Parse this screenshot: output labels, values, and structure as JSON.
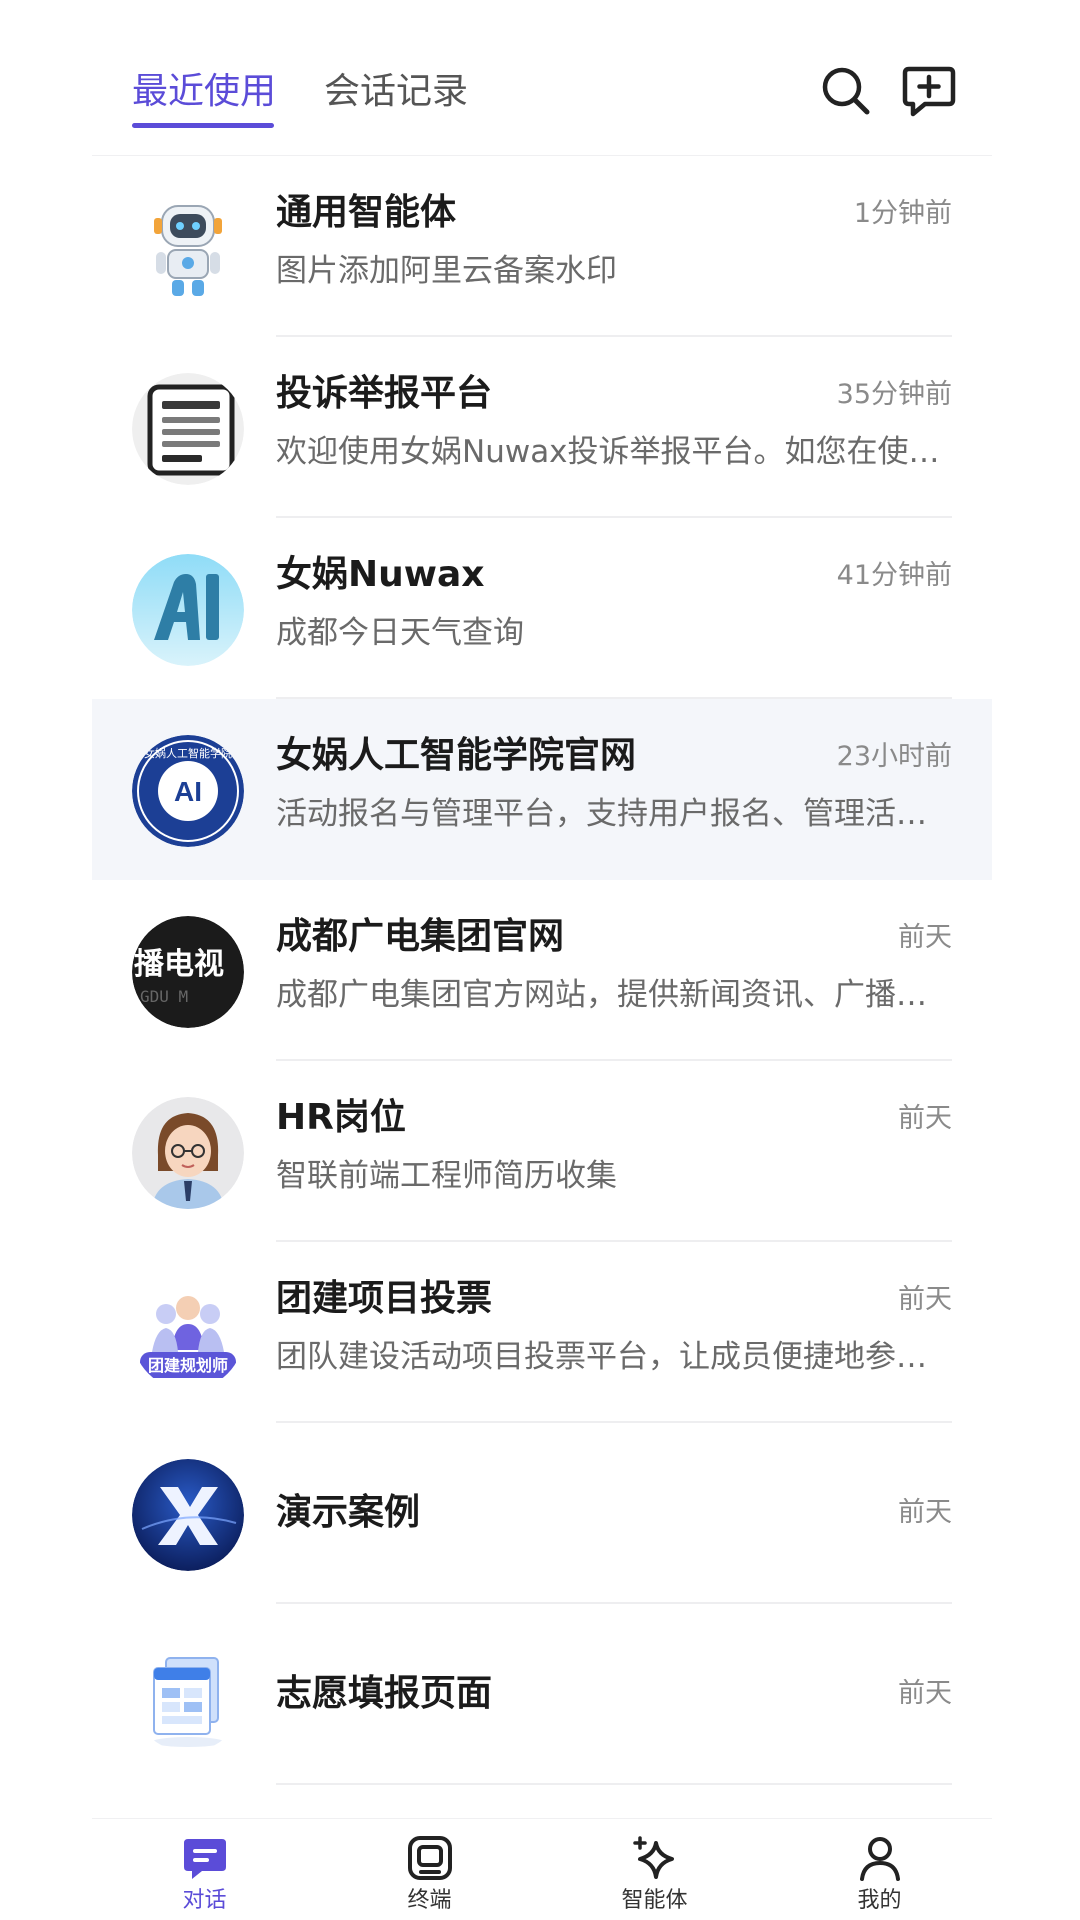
{
  "header": {
    "tabs": [
      {
        "label": "最近使用",
        "active": true
      },
      {
        "label": "会话记录",
        "active": false
      }
    ],
    "icons": [
      "search-icon",
      "new-chat-icon"
    ],
    "accent_color": "#5b4cd8"
  },
  "conversations": [
    {
      "title": "通用智能体",
      "time": "1分钟前",
      "subtitle": "图片添加阿里云备案水印",
      "avatar": "robot-avatar"
    },
    {
      "title": "投诉举报平台",
      "time": "35分钟前",
      "subtitle": "欢迎使用女娲Nuwax投诉举报平台。如您在使用过程中遇到问题",
      "avatar": "document-avatar"
    },
    {
      "title": "女娲Nuwax",
      "time": "41分钟前",
      "subtitle": "成都今日天气查询",
      "avatar": "ai-logo-avatar"
    },
    {
      "title": "女娲人工智能学院官网",
      "time": "23小时前",
      "subtitle": "活动报名与管理平台，支持用户报名、管理活动信息",
      "avatar": "school-seal-avatar",
      "avatar_text": "女娲人工智能学院",
      "highlighted": true
    },
    {
      "title": "成都广电集团官网",
      "time": "前天",
      "subtitle": "成都广电集团官方网站，提供新闻资讯、广播电视节目",
      "avatar": "broadcast-avatar",
      "avatar_text": "播电视"
    },
    {
      "title": "HR岗位",
      "time": "前天",
      "subtitle": "智联前端工程师简历收集",
      "avatar": "hr-person-avatar"
    },
    {
      "title": "团建项目投票",
      "time": "前天",
      "subtitle": "团队建设活动项目投票平台，让成员便捷地参与投票",
      "avatar": "team-planner-avatar",
      "avatar_text": "团建规划师"
    },
    {
      "title": "演示案例",
      "time": "前天",
      "subtitle": "",
      "avatar": "x-logo-avatar"
    },
    {
      "title": "志愿填报页面",
      "time": "前天",
      "subtitle": "",
      "avatar": "form-pages-avatar"
    }
  ],
  "bottom_nav": [
    {
      "label": "对话",
      "icon": "chat-icon",
      "active": true
    },
    {
      "label": "终端",
      "icon": "terminal-icon",
      "active": false
    },
    {
      "label": "智能体",
      "icon": "sparkle-icon",
      "active": false
    },
    {
      "label": "我的",
      "icon": "user-icon",
      "active": false
    }
  ]
}
